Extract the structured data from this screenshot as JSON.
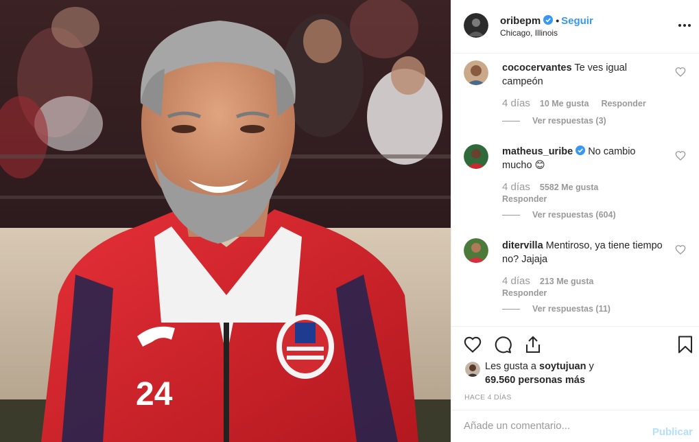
{
  "post": {
    "photo_alt": "",
    "jersey_number": "24"
  },
  "header": {
    "username": "oribepm",
    "separator": "•",
    "follow_label": "Seguir",
    "location": "Chicago, Illinois"
  },
  "comments": [
    {
      "username": "cococervantes",
      "text": "Te ves igual campeón",
      "time": "4 días",
      "likes": "10 Me gusta",
      "reply": "Responder",
      "view_replies": "Ver respuestas (3)",
      "verified": false
    },
    {
      "username": "matheus_uribe",
      "text": "No cambio mucho 😊",
      "time": "4 días",
      "likes": "5582 Me gusta",
      "reply": "Responder",
      "view_replies": "Ver respuestas (604)",
      "verified": true
    },
    {
      "username": "ditervilla",
      "text": "Mentiroso, ya tiene tiempo no? Jajaja",
      "time": "4 días",
      "likes": "213 Me gusta",
      "reply": "Responder",
      "view_replies": "Ver respuestas (11)",
      "verified": false
    }
  ],
  "likes_summary": {
    "prefix": "Les gusta a ",
    "user": "soytujuan",
    "connector": " y",
    "count": "69.560 personas más"
  },
  "time_ago": "HACE 4 DÍAS",
  "add_comment": {
    "placeholder": "Añade un comentario...",
    "publish_label": "Publicar"
  },
  "colors": {
    "link_blue": "#3897f0",
    "muted": "#999999",
    "publish_disabled": "#b2dffc",
    "jacket_red": "#d9262c"
  },
  "icons": {
    "header": [
      "verified-badge-icon",
      "more-options-icon"
    ],
    "actions": [
      "heart-icon",
      "comment-icon",
      "share-icon",
      "bookmark-icon"
    ]
  }
}
